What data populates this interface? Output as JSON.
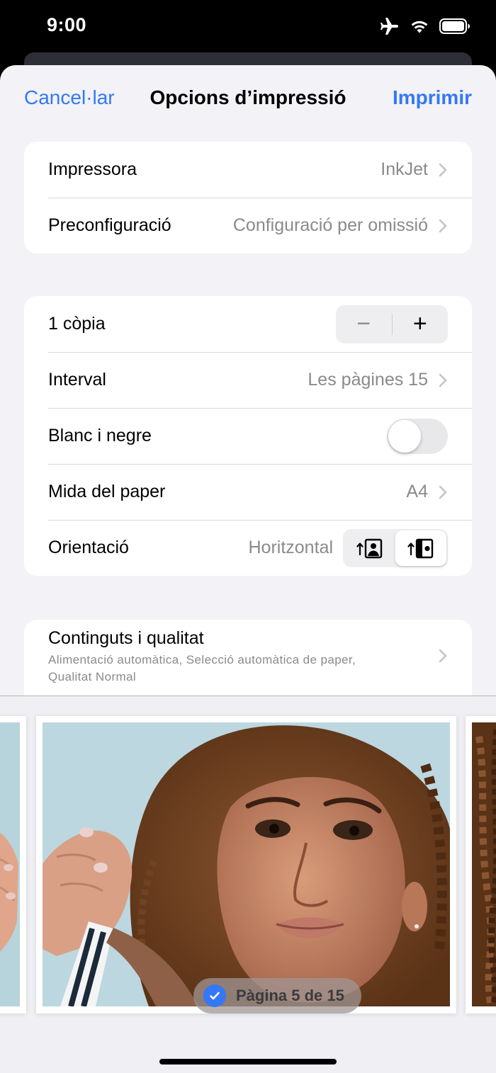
{
  "status_bar": {
    "time": "9:00"
  },
  "nav": {
    "cancel": "Cancel·lar",
    "title": "Opcions d’impressió",
    "print": "Imprimir"
  },
  "printer_group": {
    "printer": {
      "label": "Impressora",
      "value": "InkJet"
    },
    "preset": {
      "label": "Preconfiguració",
      "value": "Configuració per omissió"
    }
  },
  "options_group": {
    "copies": {
      "label": "1 còpia",
      "minus": "−",
      "plus": "+"
    },
    "range": {
      "label": "Interval",
      "value": "Les pàgines 15"
    },
    "black_white": {
      "label": "Blanc i negre",
      "enabled": false
    },
    "paper_size": {
      "label": "Mida del paper",
      "value": "A4"
    },
    "orientation": {
      "label": "Orientació",
      "value": "Horitzontal",
      "selected": "landscape"
    }
  },
  "quality_group": {
    "title": "Continguts i qualitat",
    "subtitle_line1": "Alimentació automàtica, Selecció automàtica de paper,",
    "subtitle_line2": "Qualitat Normal"
  },
  "preview": {
    "badge": "Pàgina 5 de 15",
    "selected": true
  },
  "colors": {
    "accent": "#3478f6",
    "sheet_bg": "#f2f2f7",
    "secondary_text": "#8a8a8e"
  }
}
